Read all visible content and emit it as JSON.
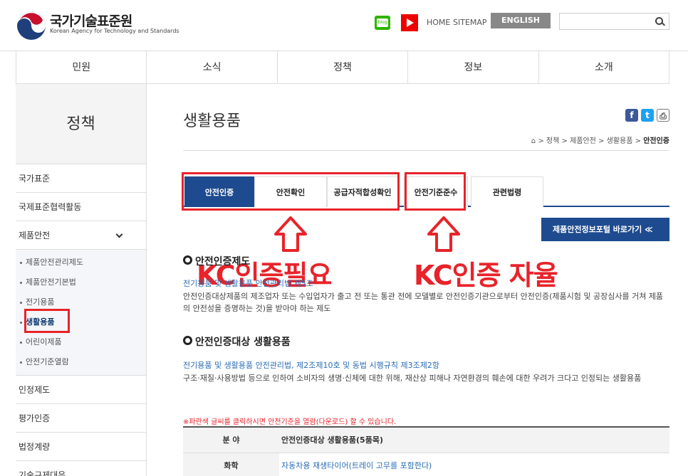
{
  "header": {
    "brand_ko": "국가기술표준원",
    "brand_en": "Korean Agency for Technology and Standards",
    "blog_label": "blog",
    "home_label": "HOME",
    "sitemap_label": "SITEMAP",
    "english_label": "ENGLISH",
    "search_placeholder": ""
  },
  "gnb": [
    "민원",
    "소식",
    "정책",
    "정보",
    "소개"
  ],
  "sidebar": {
    "title": "정책",
    "items": [
      "국가표준",
      "국제표준협력활동",
      "제품안전"
    ],
    "sub_items": [
      "제품안전관리제도",
      "제품안전기본법",
      "전기용품",
      "생활용품",
      "어린이제품",
      "안전기준열람"
    ],
    "items_after": [
      "인정제도",
      "평가인증",
      "법정계량",
      "기술규제대응"
    ]
  },
  "page": {
    "title": "생활용품",
    "sns": {
      "facebook": "f",
      "twitter": "t",
      "print": "⎙"
    },
    "breadcrumb": [
      "⌂",
      "정책",
      "제품안전",
      "생활용품",
      "안전인증"
    ]
  },
  "tabs": [
    "안전인증",
    "안전확인",
    "공급자적합성확인",
    "안전기준준수",
    "관련법령"
  ],
  "portal_button": "제품안전정보포털 바로가기  ≪",
  "annotations": {
    "left": "KC인증필요",
    "right": "KC인증 자율"
  },
  "section1": {
    "title": "안전인증제도",
    "link": "전기용품 및 생활용품 안전관리법 제5조",
    "text": "안전인증대상제품의 제조업자 또는 수입업자가 출고 전 또는 통관 전에 모델별로 안전인증기관으로부터 안전인증(제품시험 및 공장심사를 거쳐 제품의 안전성을 증명하는 것)을 받아야 하는 제도"
  },
  "section2": {
    "title": "안전인증대상 생활용품",
    "link": "전기용품 및 생활용품 안전관리법, 제2조제10호 및 동법 시행규칙 제3조제2항",
    "text": "구조·재질·사용방법 등으로 인하여 소비자의 생명·신체에 대한 위해, 재산상 피해나 자연환경의 훼손에 대한 우려가 크다고 인정되는 생활용품"
  },
  "notice": "※파란색 글씨를 클릭하시면 안전기준을 열람(다운로드) 할 수 있습니다.",
  "table": {
    "headers": [
      "분 야",
      "안전인증대상 생활용품(5품목)"
    ],
    "rows": [
      [
        "화학",
        "자동차용 재생타이어(트레이 고무를 포함한다)"
      ]
    ]
  },
  "colors": {
    "accent": "#1e4b8f",
    "annotation": "#e8232a"
  }
}
